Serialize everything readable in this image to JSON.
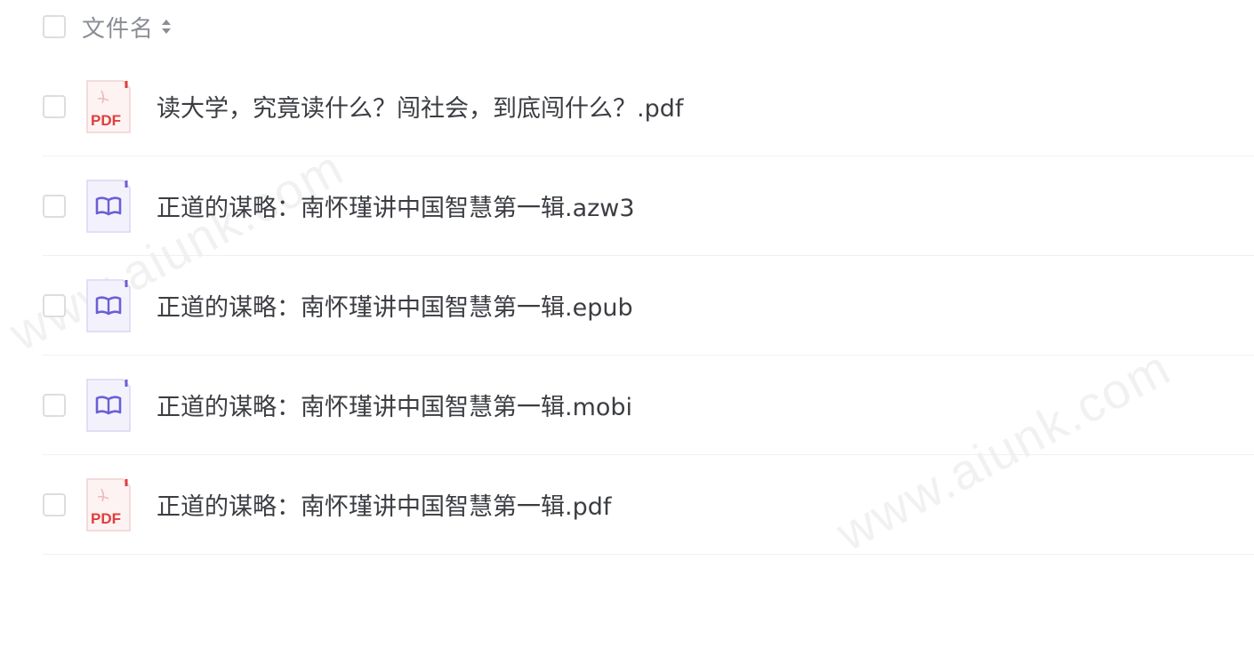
{
  "header": {
    "column_label": "文件名",
    "sort_icon": "sort-icon"
  },
  "files": [
    {
      "name": "读大学，究竟读什么？闯社会，到底闯什么？.pdf",
      "icon": "pdf-icon",
      "type": "pdf"
    },
    {
      "name": "正道的谋略：南怀瑾讲中国智慧第一辑.azw3",
      "icon": "ebook-icon",
      "type": "ebook"
    },
    {
      "name": "正道的谋略：南怀瑾讲中国智慧第一辑.epub",
      "icon": "ebook-icon",
      "type": "ebook"
    },
    {
      "name": "正道的谋略：南怀瑾讲中国智慧第一辑.mobi",
      "icon": "ebook-icon",
      "type": "ebook"
    },
    {
      "name": "正道的谋略：南怀瑾讲中国智慧第一辑.pdf",
      "icon": "pdf-icon",
      "type": "pdf"
    }
  ],
  "icon_labels": {
    "pdf": "PDF"
  },
  "watermark": {
    "text": "www.aiunk.com"
  },
  "colors": {
    "pdf_red": "#e23d3d",
    "ebook_purple": "#6a5fd6",
    "text": "#3b3d42",
    "header_text": "#8a8d94",
    "divider": "#eef0f3"
  }
}
